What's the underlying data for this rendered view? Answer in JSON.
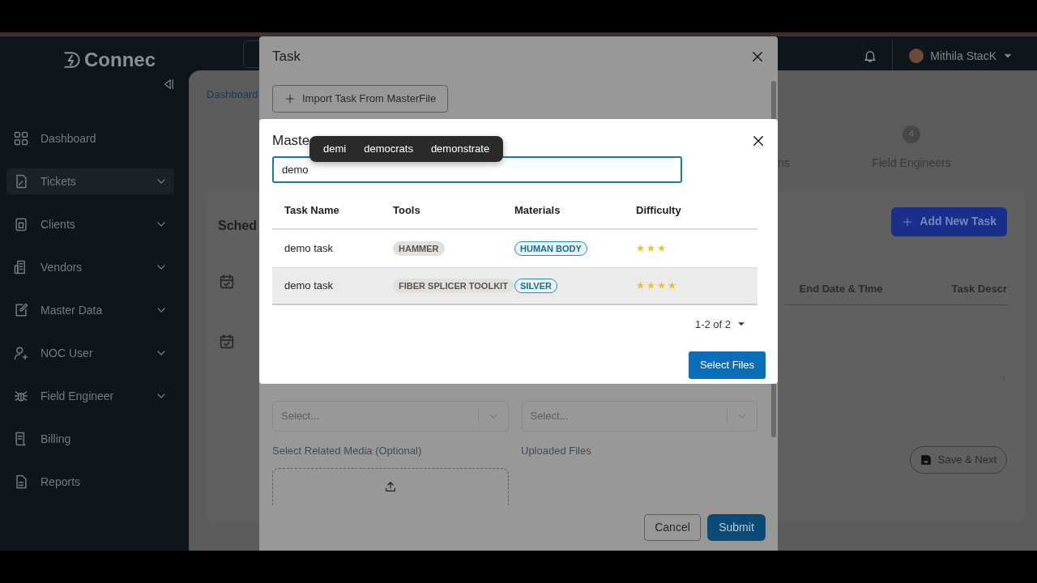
{
  "header": {
    "logo": "Connec",
    "user": "Mithila StacK"
  },
  "sidebar": {
    "items": [
      {
        "label": "Dashboard",
        "expandable": false,
        "selected": false
      },
      {
        "label": "Tickets",
        "expandable": true,
        "selected": true
      },
      {
        "label": "Clients",
        "expandable": true,
        "selected": false
      },
      {
        "label": "Vendors",
        "expandable": true,
        "selected": false
      },
      {
        "label": "Master Data",
        "expandable": true,
        "selected": false
      },
      {
        "label": "NOC User",
        "expandable": true,
        "selected": false
      },
      {
        "label": "Field Engineer",
        "expandable": true,
        "selected": false
      },
      {
        "label": "Billing",
        "expandable": false,
        "selected": false
      },
      {
        "label": "Reports",
        "expandable": false,
        "selected": false
      }
    ]
  },
  "page": {
    "breadcrumb": "Dashboard",
    "stepper": {
      "partial_label": "ns",
      "step_number": "4",
      "step_label": "Field Engineers"
    },
    "section_title": "Sched",
    "add_button": "Add New Task",
    "table": {
      "columns": [
        "End Date & Time",
        "Task Descr"
      ]
    },
    "save_button": "Save & Next"
  },
  "task_modal": {
    "title": "Task",
    "import_button": "Import Task From MasterFile",
    "selects": [
      {
        "placeholder": "Select..."
      },
      {
        "placeholder": "Select..."
      }
    ],
    "media_label": "Select Related Media (Optional)",
    "uploaded_label": "Uploaded Files",
    "buttons": {
      "cancel": "Cancel",
      "submit": "Submit"
    }
  },
  "master_modal": {
    "title": "Maste",
    "search": {
      "value": "demo"
    },
    "suggestions": [
      "demi",
      "democrats",
      "demonstrate"
    ],
    "table": {
      "columns": [
        "Task Name",
        "Tools",
        "Materials",
        "Difficulty"
      ],
      "rows": [
        {
          "task_name": "demo task",
          "tools": "HAMMER",
          "materials": "HUMAN BODY",
          "stars": 3,
          "hovered": false
        },
        {
          "task_name": "demo task",
          "tools": "FIBER SPLICER TOOLKIT",
          "materials": "SILVER",
          "stars": 4,
          "hovered": true
        }
      ]
    },
    "pagination": "1-2 of 2",
    "select_button": "Select Files"
  }
}
